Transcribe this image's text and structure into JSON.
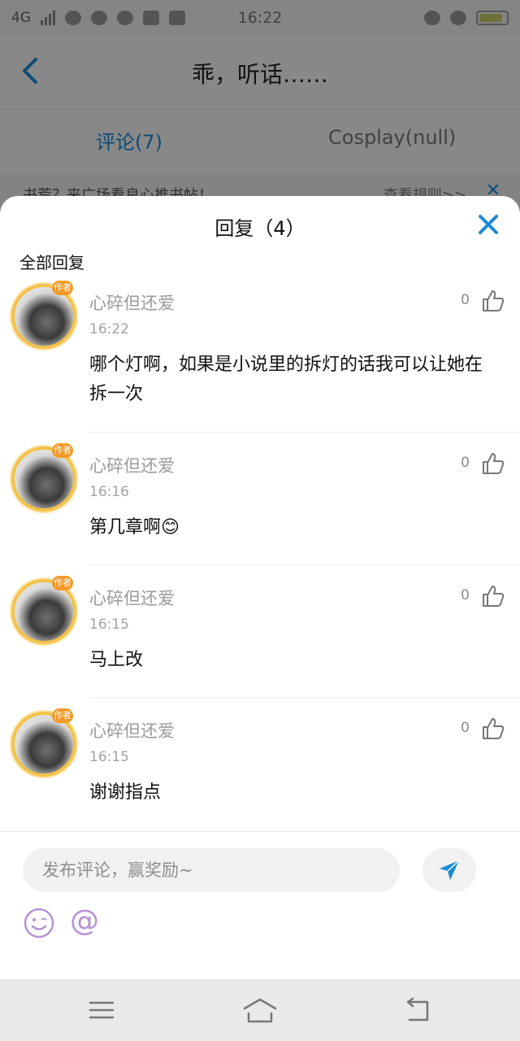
{
  "status_bar": {
    "network": "4G",
    "time": "16:22"
  },
  "header": {
    "title": "乖，听话……"
  },
  "tabs": [
    {
      "label": "评论(7)",
      "active": true
    },
    {
      "label": "Cosplay(null)",
      "active": false
    }
  ],
  "notice": {
    "text": "书荒？来广场看良心推书帖！",
    "rule": "查看规则>>"
  },
  "sheet": {
    "title": "回复（4）",
    "section_label": "全部回复"
  },
  "replies": [
    {
      "name": "心碎但还爱",
      "time": "16:22",
      "likes": "0",
      "text": "哪个灯啊，如果是小说里的拆灯的话我可以让她在拆一次",
      "badge": "作者"
    },
    {
      "name": "心碎但还爱",
      "time": "16:16",
      "likes": "0",
      "text": "第几章啊😊",
      "badge": "作者"
    },
    {
      "name": "心碎但还爱",
      "time": "16:15",
      "likes": "0",
      "text": "马上改",
      "badge": "作者"
    },
    {
      "name": "心碎但还爱",
      "time": "16:15",
      "likes": "0",
      "text": "谢谢指点",
      "badge": "作者"
    }
  ],
  "composer": {
    "placeholder": "发布评论，赢奖励~",
    "at_symbol": "@"
  },
  "colors": {
    "accent": "#1a8bd8",
    "author_ring": "#f3c24a",
    "emoji_purple": "#b791d6"
  }
}
